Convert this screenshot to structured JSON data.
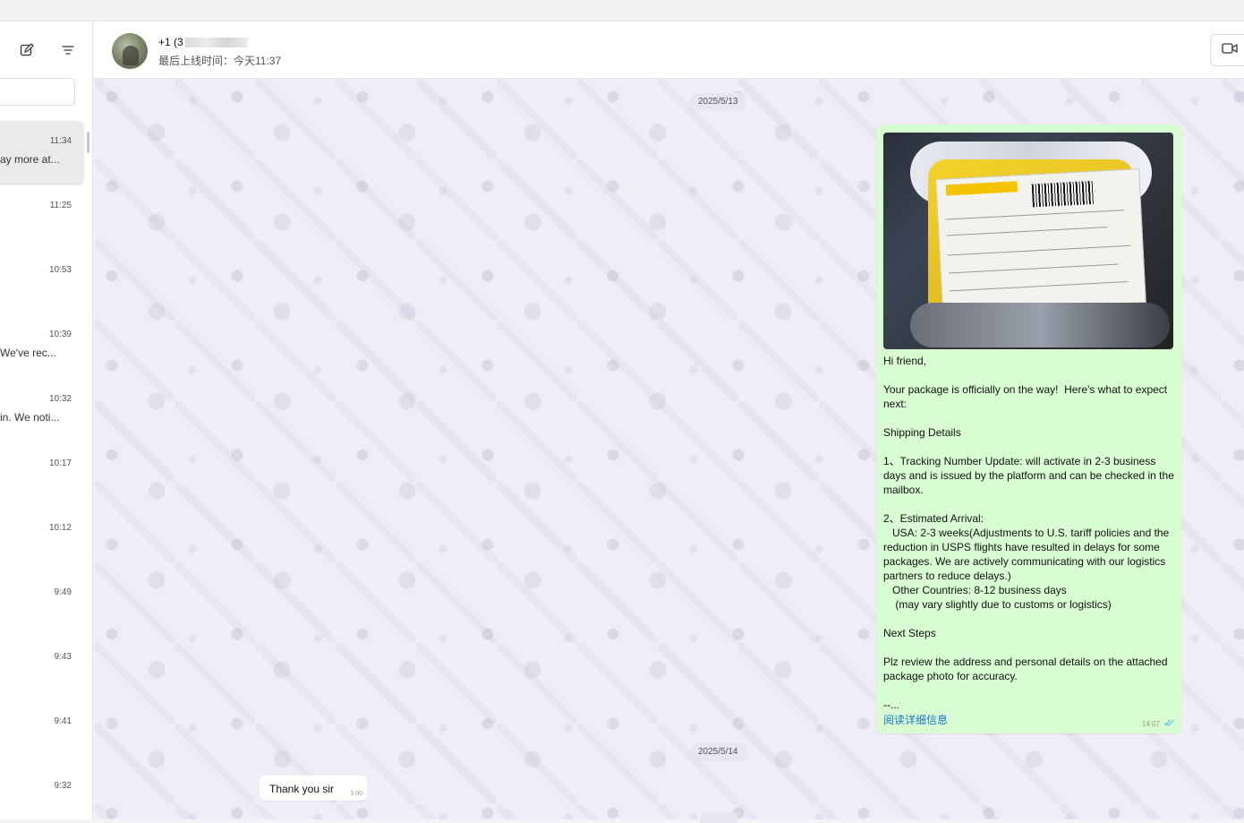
{
  "sidebar": {
    "chats": [
      {
        "time": "11:34",
        "preview": "ay more at...",
        "active": true
      },
      {
        "time": "11:25",
        "preview": ""
      },
      {
        "time": "10:53",
        "preview": ""
      },
      {
        "time": "10:39",
        "preview": "We've rec..."
      },
      {
        "time": "10:32",
        "preview": "in. We noti..."
      },
      {
        "time": "10:17",
        "preview": ""
      },
      {
        "time": "10:12",
        "preview": ""
      },
      {
        "time": "9:49",
        "preview": ""
      },
      {
        "time": "9:43",
        "preview": ""
      },
      {
        "time": "9:41",
        "preview": ""
      },
      {
        "time": "9:32",
        "preview": ""
      }
    ],
    "icons": [
      "compose-icon",
      "filter-icon"
    ]
  },
  "header": {
    "contact_name_prefix": "+1 (3",
    "last_seen": "最后上线时间：今天11:37",
    "video_icon": "video-icon"
  },
  "messages": {
    "date1": "2025/5/13",
    "outgoing": {
      "text": "Hi friend,\n\nYour package is officially on the way!  Here's what to expect next:\n\nShipping Details\n\n1、Tracking Number Update: will activate in 2-3 business days and is issued by the platform and can be checked in the mailbox.\n\n2、Estimated Arrival:\n   USA: 2-3 weeks(Adjustments to U.S. tariff policies and the reduction in USPS flights have resulted in delays for some packages. We are actively communicating with our logistics partners to reduce delays.)\n   Other Countries: 8-12 business days\n    (may vary slightly due to customs or logistics)\n\nNext Steps\n\nPlz review the address and personal details on the attached package photo for accuracy.\n\n--...",
      "read_more": "阅读详细信息",
      "time": "14:07",
      "status_icon": "double-check-icon",
      "status_color": "#53bdeb"
    },
    "date2": "2025/5/14",
    "incoming": {
      "text": "Thank you sir",
      "time": "3:00"
    }
  }
}
